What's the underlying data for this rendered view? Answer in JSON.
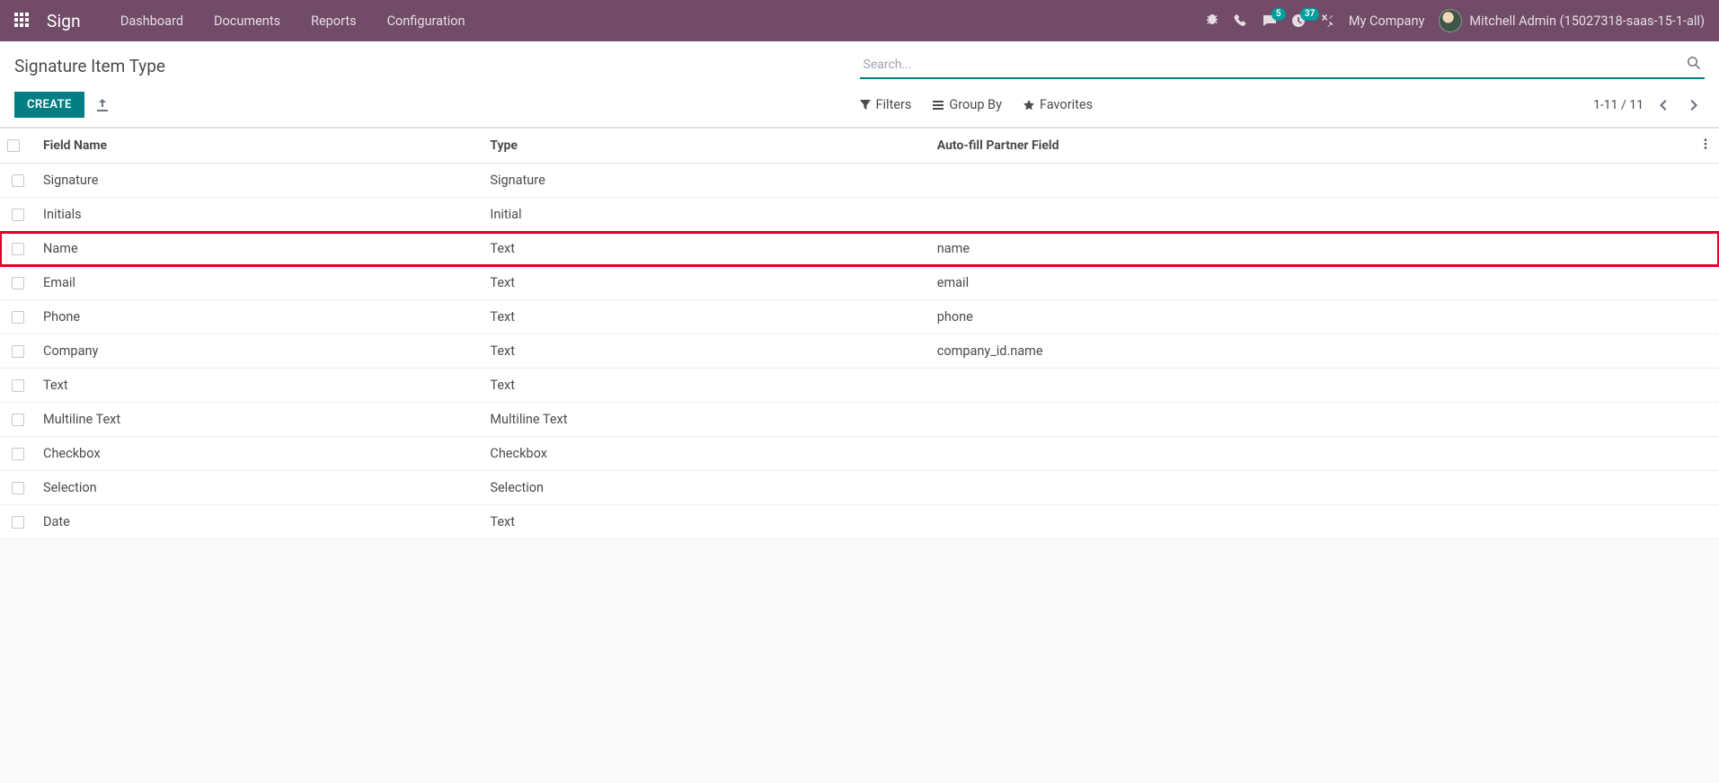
{
  "nav": {
    "brand": "Sign",
    "items": [
      "Dashboard",
      "Documents",
      "Reports",
      "Configuration"
    ],
    "company": "My Company",
    "badges": {
      "messages": "5",
      "activities": "37"
    },
    "user": "Mitchell Admin (15027318-saas-15-1-all)"
  },
  "page": {
    "title": "Signature Item Type",
    "create": "CREATE",
    "search_placeholder": "Search...",
    "filters": "Filters",
    "groupby": "Group By",
    "favorites": "Favorites",
    "pager": "1-11 / 11"
  },
  "table": {
    "headers": {
      "field": "Field Name",
      "type": "Type",
      "auto": "Auto-fill Partner Field"
    },
    "rows": [
      {
        "field": "Signature",
        "type": "Signature",
        "auto": ""
      },
      {
        "field": "Initials",
        "type": "Initial",
        "auto": ""
      },
      {
        "field": "Name",
        "type": "Text",
        "auto": "name",
        "highlight": true
      },
      {
        "field": "Email",
        "type": "Text",
        "auto": "email"
      },
      {
        "field": "Phone",
        "type": "Text",
        "auto": "phone"
      },
      {
        "field": "Company",
        "type": "Text",
        "auto": "company_id.name"
      },
      {
        "field": "Text",
        "type": "Text",
        "auto": ""
      },
      {
        "field": "Multiline Text",
        "type": "Multiline Text",
        "auto": ""
      },
      {
        "field": "Checkbox",
        "type": "Checkbox",
        "auto": ""
      },
      {
        "field": "Selection",
        "type": "Selection",
        "auto": ""
      },
      {
        "field": "Date",
        "type": "Text",
        "auto": ""
      }
    ]
  }
}
